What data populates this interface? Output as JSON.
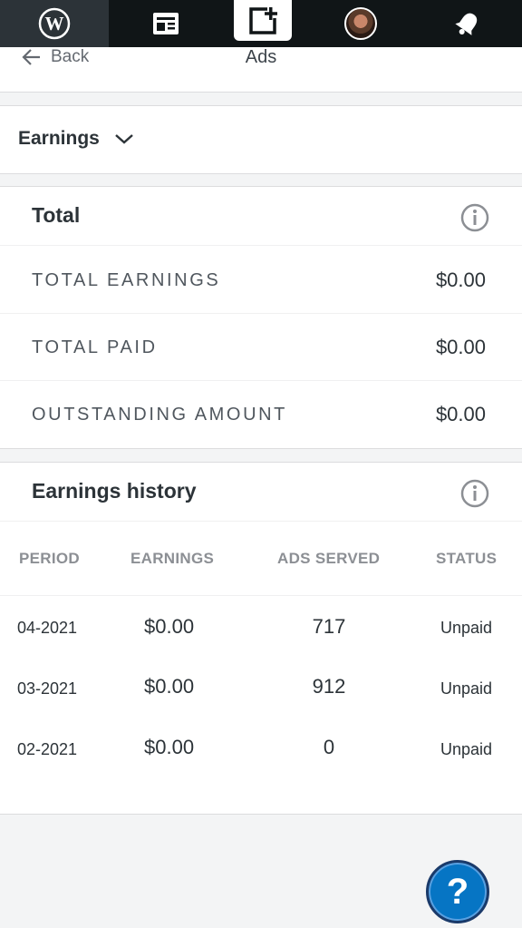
{
  "nav": {
    "back_label": "Back",
    "title": "Ads"
  },
  "section_dropdown": {
    "label": "Earnings"
  },
  "total": {
    "title": "Total",
    "rows": [
      {
        "label": "TOTAL EARNINGS",
        "value": "$0.00"
      },
      {
        "label": "TOTAL PAID",
        "value": "$0.00"
      },
      {
        "label": "OUTSTANDING AMOUNT",
        "value": "$0.00"
      }
    ]
  },
  "history": {
    "title": "Earnings history",
    "columns": [
      "PERIOD",
      "EARNINGS",
      "ADS SERVED",
      "STATUS"
    ],
    "rows": [
      {
        "period": "04-2021",
        "earnings": "$0.00",
        "ads_served": "717",
        "status": "Unpaid"
      },
      {
        "period": "03-2021",
        "earnings": "$0.00",
        "ads_served": "912",
        "status": "Unpaid"
      },
      {
        "period": "02-2021",
        "earnings": "$0.00",
        "ads_served": "0",
        "status": "Unpaid"
      }
    ]
  },
  "help_button": {
    "label": "?"
  },
  "colors": {
    "topbar": "#101517",
    "help": "#0675c4",
    "muted": "#8c8f94"
  },
  "icons": [
    "wordpress-icon",
    "reader-icon",
    "write-icon",
    "avatar",
    "notifications-icon",
    "back-arrow-icon",
    "chevron-down-icon",
    "info-icon"
  ]
}
